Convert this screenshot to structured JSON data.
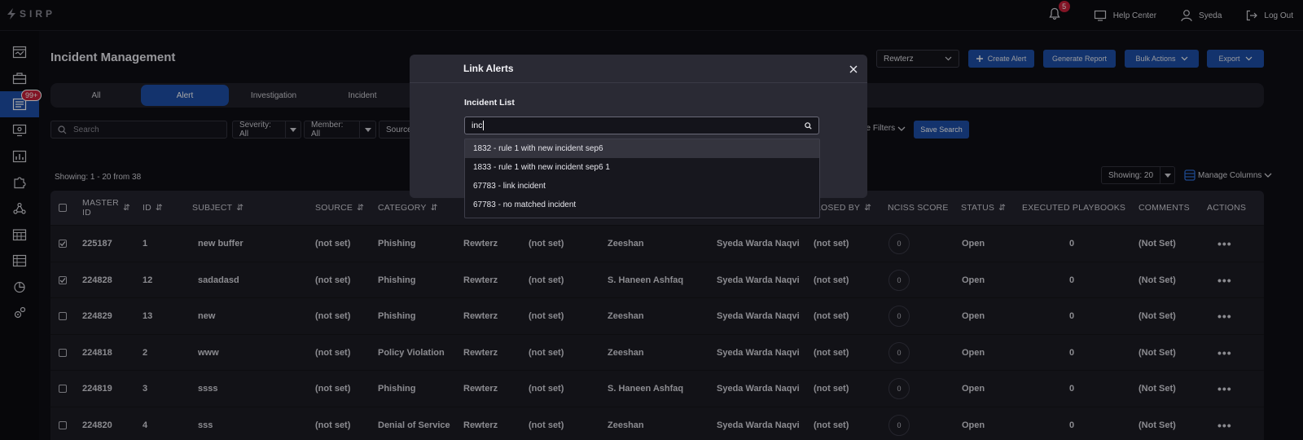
{
  "app": {
    "logo": "SIRP"
  },
  "topbar": {
    "notifications_count": "5",
    "help_label": "Help Center",
    "user_label": "Syeda",
    "logout_label": "Log Out"
  },
  "sidebar": {
    "badge": "99+"
  },
  "page": {
    "title": "Incident Management"
  },
  "header_actions": {
    "org_select": "Rewterz",
    "create_alert": "Create Alert",
    "generate_report": "Generate Report",
    "bulk_actions": "Bulk Actions",
    "export": "Export"
  },
  "tabs": [
    "All",
    "Alert",
    "Investigation",
    "Incident"
  ],
  "filters": {
    "search_placeholder": "Search",
    "severity": "Severity: All",
    "member": "Member: All",
    "source": "Source",
    "more_filters": "ge Filters",
    "save_search": "Save Search"
  },
  "listing": {
    "showing": "Showing: 1 - 20 from 38",
    "page_size": "Showing: 20",
    "manage_columns": "Manage Columns"
  },
  "table": {
    "headers": {
      "master_id_1": "MASTER",
      "master_id_2": "ID",
      "id": "ID",
      "subject": "SUBJECT",
      "source": "SOURCE",
      "category": "CATEGORY",
      "closed_by": "LOSED BY",
      "nciss": "NCISS SCORE",
      "status": "STATUS",
      "playbooks": "EXECUTED PLAYBOOKS",
      "comments": "COMMENTS",
      "actions": "ACTIONS"
    },
    "rows": [
      {
        "checked": true,
        "master": "225187",
        "id": "1",
        "subject": "new buffer",
        "source": "(not set)",
        "category": "Phishing",
        "org": "Rewterz",
        "col7": "(not set)",
        "col8": "Zeeshan",
        "col9": "Syeda Warda Naqvi",
        "closed_by": "(not set)",
        "score": "0",
        "status": "Open",
        "playbooks": "0",
        "comments": "(Not Set)"
      },
      {
        "checked": true,
        "master": "224828",
        "id": "12",
        "subject": "sadadasd",
        "source": "(not set)",
        "category": "Phishing",
        "org": "Rewterz",
        "col7": "(not set)",
        "col8": "S. Haneen Ashfaq",
        "col9": "Syeda Warda Naqvi",
        "closed_by": "(not set)",
        "score": "0",
        "status": "Open",
        "playbooks": "0",
        "comments": "(Not Set)"
      },
      {
        "checked": false,
        "master": "224829",
        "id": "13",
        "subject": "new",
        "source": "(not set)",
        "category": "Phishing",
        "org": "Rewterz",
        "col7": "(not set)",
        "col8": "Zeeshan",
        "col9": "Syeda Warda Naqvi",
        "closed_by": "(not set)",
        "score": "0",
        "status": "Open",
        "playbooks": "0",
        "comments": "(Not Set)"
      },
      {
        "checked": false,
        "master": "224818",
        "id": "2",
        "subject": "www",
        "source": "(not set)",
        "category": "Policy Violation",
        "org": "Rewterz",
        "col7": "(not set)",
        "col8": "Zeeshan",
        "col9": "Syeda Warda Naqvi",
        "closed_by": "(not set)",
        "score": "0",
        "status": "Open",
        "playbooks": "0",
        "comments": "(Not Set)"
      },
      {
        "checked": false,
        "master": "224819",
        "id": "3",
        "subject": "ssss",
        "source": "(not set)",
        "category": "Phishing",
        "org": "Rewterz",
        "col7": "(not set)",
        "col8": "S. Haneen Ashfaq",
        "col9": "Syeda Warda Naqvi",
        "closed_by": "(not set)",
        "score": "0",
        "status": "Open",
        "playbooks": "0",
        "comments": "(Not Set)"
      },
      {
        "checked": false,
        "master": "224820",
        "id": "4",
        "subject": "sss",
        "source": "(not set)",
        "category": "Denial of Service",
        "org": "Rewterz",
        "col7": "(not set)",
        "col8": "Zeeshan",
        "col9": "Syeda Warda Naqvi",
        "closed_by": "(not set)",
        "score": "0",
        "status": "Open",
        "playbooks": "0",
        "comments": "(Not Set)"
      }
    ]
  },
  "modal": {
    "title": "Link Alerts",
    "field_label": "Incident List",
    "input_value": "inc",
    "options": [
      "1832 - rule 1 with new incident sep6",
      "1833 - rule 1 with new incident sep6 1",
      "67783 - link incident",
      "67783 - no matched incident"
    ]
  }
}
